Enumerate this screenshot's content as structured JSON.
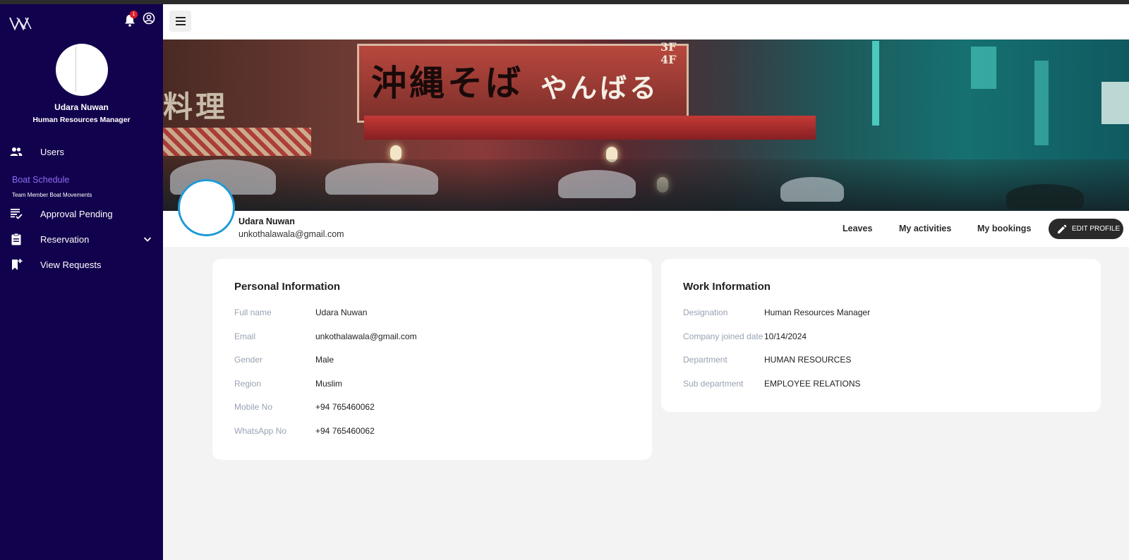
{
  "sidebar": {
    "user_name": "Udara Nuwan",
    "user_role": "Human Resources Manager",
    "notification_count": "1",
    "items": [
      {
        "label": "Users",
        "icon": "people-icon"
      },
      {
        "label": "Approval Pending",
        "icon": "checklist-icon"
      },
      {
        "label": "Reservation",
        "icon": "clipboard-icon"
      },
      {
        "label": "View Requests",
        "icon": "bookmark-add-icon"
      }
    ],
    "section_title": "Boat Schedule",
    "section_subtitle": "Team Member Boat Movements"
  },
  "profile": {
    "name": "Udara Nuwan",
    "email": "unkothalawala@gmail.com",
    "tabs": [
      "Leaves",
      "My activities",
      "My bookings"
    ],
    "edit_label": "EDIT PROFILE"
  },
  "banner": {
    "sign_text": "沖縄そば",
    "sign_text_white": "やんばる",
    "left_text": "料理",
    "floor_text": "3F 4F"
  },
  "personal_info": {
    "title": "Personal Information",
    "fields": [
      {
        "label": "Full name",
        "value": "Udara Nuwan"
      },
      {
        "label": "Email",
        "value": "unkothalawala@gmail.com"
      },
      {
        "label": "Gender",
        "value": "Male"
      },
      {
        "label": "Region",
        "value": "Muslim"
      },
      {
        "label": "Mobile No",
        "value": "+94 765460062"
      },
      {
        "label": "WhatsApp No",
        "value": "+94 765460062"
      }
    ]
  },
  "work_info": {
    "title": "Work Information",
    "fields": [
      {
        "label": "Designation",
        "value": "Human Resources Manager"
      },
      {
        "label": "Company joined date",
        "value": "10/14/2024"
      },
      {
        "label": "Department",
        "value": "HUMAN RESOURCES"
      },
      {
        "label": "Sub department",
        "value": "EMPLOYEE RELATIONS"
      }
    ]
  },
  "colors": {
    "sidebar_bg": "#12024d",
    "accent_purple": "#8f6cf5",
    "avatar_ring": "#1e9ad6",
    "badge": "#e0202a"
  }
}
